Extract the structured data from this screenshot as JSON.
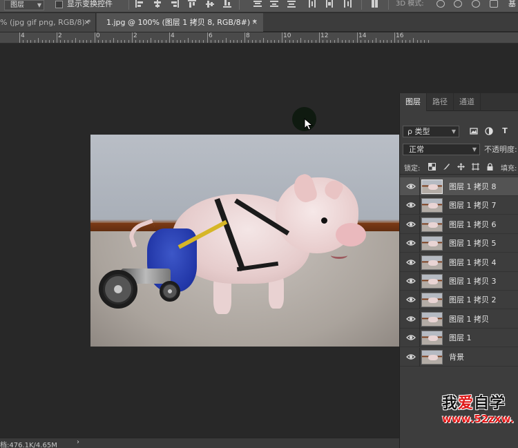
{
  "options_bar": {
    "layer_select": "图层",
    "show_transform_label": "显示变换控件",
    "mode_3d_label": "3D 模式:",
    "trailing_text": "基"
  },
  "tabs": [
    {
      "label": "% (jpg gif png, RGB/8) *",
      "close": "×",
      "active": false
    },
    {
      "label": "1.jpg @ 100% (图层 1 拷贝 8, RGB/8#) *",
      "close": "×",
      "active": true
    }
  ],
  "ruler": {
    "labels": [
      "4",
      "2",
      "0",
      "2",
      "4",
      "6",
      "8",
      "10",
      "12",
      "14",
      "16"
    ]
  },
  "layers_panel": {
    "tabs": [
      {
        "label": "图层",
        "active": true
      },
      {
        "label": "路径",
        "active": false
      },
      {
        "label": "通道",
        "active": false
      }
    ],
    "filter_select": "ρ 类型",
    "filter_icons": [
      "image-filter-icon",
      "adjustment-filter-icon",
      "type-filter-icon"
    ],
    "filter_type_glyph": "T",
    "blend_mode": "正常",
    "opacity_label": "不透明度:",
    "lock_label": "锁定:",
    "fill_label": "填充:",
    "layers": [
      {
        "name": "图层 1 拷贝 8",
        "selected": true
      },
      {
        "name": "图层 1 拷贝 7",
        "selected": false
      },
      {
        "name": "图层 1 拷贝 6",
        "selected": false
      },
      {
        "name": "图层 1 拷贝 5",
        "selected": false
      },
      {
        "name": "图层 1 拷贝 4",
        "selected": false
      },
      {
        "name": "图层 1 拷贝 3",
        "selected": false
      },
      {
        "name": "图层 1 拷贝 2",
        "selected": false
      },
      {
        "name": "图层 1 拷贝",
        "selected": false
      },
      {
        "name": "图层 1",
        "selected": false
      },
      {
        "name": "背景",
        "selected": false
      }
    ]
  },
  "status_bar": {
    "doc_size": "档:476.1K/4.65M",
    "arrow": "›"
  },
  "watermark": {
    "line1_a": "我",
    "line1_heart": "爱",
    "line1_b": "自学",
    "line2": "www.52zxw."
  },
  "colors": {
    "workspace_bg": "#282828",
    "panel_bg": "#3d3d3d",
    "selected_layer": "#535353",
    "watermark_red": "#e01818"
  }
}
